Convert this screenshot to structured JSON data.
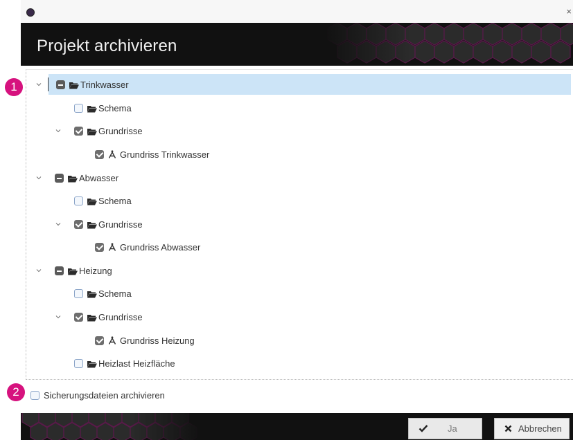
{
  "window": {
    "title": "",
    "close_label": "×"
  },
  "header": {
    "title": "Projekt archivieren"
  },
  "badges": {
    "one": "1",
    "two": "2"
  },
  "tree": {
    "items": [
      {
        "label": "Trinkwasser",
        "state": "partial",
        "icon": "folder-icon",
        "expanded": true,
        "selected": true
      },
      {
        "label": "Schema",
        "state": "unchecked",
        "icon": "folder-icon"
      },
      {
        "label": "Grundrisse",
        "state": "checked",
        "icon": "folder-icon",
        "expanded": true
      },
      {
        "label": "Grundriss Trinkwasser",
        "state": "checked",
        "icon": "compass-icon"
      },
      {
        "label": "Abwasser",
        "state": "partial",
        "icon": "folder-icon",
        "expanded": true
      },
      {
        "label": "Schema",
        "state": "unchecked",
        "icon": "folder-icon"
      },
      {
        "label": "Grundrisse",
        "state": "checked",
        "icon": "folder-icon",
        "expanded": true
      },
      {
        "label": "Grundriss Abwasser",
        "state": "checked",
        "icon": "compass-icon"
      },
      {
        "label": "Heizung",
        "state": "partial",
        "icon": "folder-icon",
        "expanded": true
      },
      {
        "label": "Schema",
        "state": "unchecked",
        "icon": "folder-icon"
      },
      {
        "label": "Grundrisse",
        "state": "checked",
        "icon": "folder-icon",
        "expanded": true
      },
      {
        "label": "Grundriss Heizung",
        "state": "checked",
        "icon": "compass-icon"
      },
      {
        "label": "Heizlast Heizfläche",
        "state": "unchecked",
        "icon": "folder-icon"
      }
    ]
  },
  "options": {
    "backup_label": "Sicherungsdateien archivieren",
    "backup_checked": false
  },
  "footer": {
    "ok_label": "Ja",
    "ok_icon": "check-icon",
    "cancel_label": "Abbrechen",
    "cancel_icon": "x-icon"
  },
  "colors": {
    "accent_badge": "#d6127e",
    "selected_row": "#cce4f7",
    "header_bg": "#111111"
  }
}
